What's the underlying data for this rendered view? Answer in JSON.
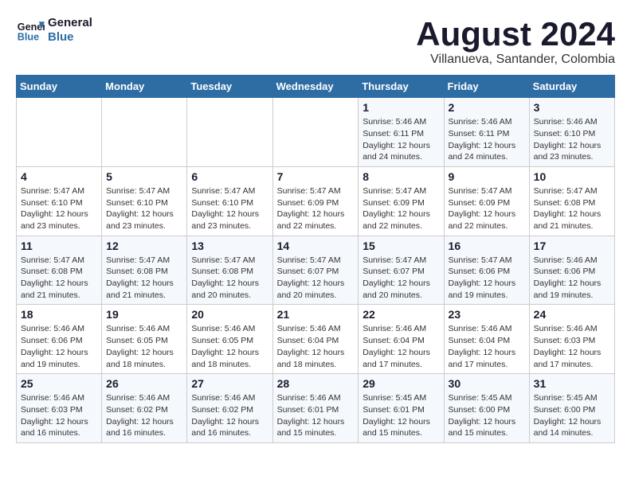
{
  "header": {
    "logo_line1": "General",
    "logo_line2": "Blue",
    "month_year": "August 2024",
    "location": "Villanueva, Santander, Colombia"
  },
  "days_of_week": [
    "Sunday",
    "Monday",
    "Tuesday",
    "Wednesday",
    "Thursday",
    "Friday",
    "Saturday"
  ],
  "weeks": [
    [
      {
        "num": "",
        "info": ""
      },
      {
        "num": "",
        "info": ""
      },
      {
        "num": "",
        "info": ""
      },
      {
        "num": "",
        "info": ""
      },
      {
        "num": "1",
        "info": "Sunrise: 5:46 AM\nSunset: 6:11 PM\nDaylight: 12 hours\nand 24 minutes."
      },
      {
        "num": "2",
        "info": "Sunrise: 5:46 AM\nSunset: 6:11 PM\nDaylight: 12 hours\nand 24 minutes."
      },
      {
        "num": "3",
        "info": "Sunrise: 5:46 AM\nSunset: 6:10 PM\nDaylight: 12 hours\nand 23 minutes."
      }
    ],
    [
      {
        "num": "4",
        "info": "Sunrise: 5:47 AM\nSunset: 6:10 PM\nDaylight: 12 hours\nand 23 minutes."
      },
      {
        "num": "5",
        "info": "Sunrise: 5:47 AM\nSunset: 6:10 PM\nDaylight: 12 hours\nand 23 minutes."
      },
      {
        "num": "6",
        "info": "Sunrise: 5:47 AM\nSunset: 6:10 PM\nDaylight: 12 hours\nand 23 minutes."
      },
      {
        "num": "7",
        "info": "Sunrise: 5:47 AM\nSunset: 6:09 PM\nDaylight: 12 hours\nand 22 minutes."
      },
      {
        "num": "8",
        "info": "Sunrise: 5:47 AM\nSunset: 6:09 PM\nDaylight: 12 hours\nand 22 minutes."
      },
      {
        "num": "9",
        "info": "Sunrise: 5:47 AM\nSunset: 6:09 PM\nDaylight: 12 hours\nand 22 minutes."
      },
      {
        "num": "10",
        "info": "Sunrise: 5:47 AM\nSunset: 6:08 PM\nDaylight: 12 hours\nand 21 minutes."
      }
    ],
    [
      {
        "num": "11",
        "info": "Sunrise: 5:47 AM\nSunset: 6:08 PM\nDaylight: 12 hours\nand 21 minutes."
      },
      {
        "num": "12",
        "info": "Sunrise: 5:47 AM\nSunset: 6:08 PM\nDaylight: 12 hours\nand 21 minutes."
      },
      {
        "num": "13",
        "info": "Sunrise: 5:47 AM\nSunset: 6:08 PM\nDaylight: 12 hours\nand 20 minutes."
      },
      {
        "num": "14",
        "info": "Sunrise: 5:47 AM\nSunset: 6:07 PM\nDaylight: 12 hours\nand 20 minutes."
      },
      {
        "num": "15",
        "info": "Sunrise: 5:47 AM\nSunset: 6:07 PM\nDaylight: 12 hours\nand 20 minutes."
      },
      {
        "num": "16",
        "info": "Sunrise: 5:47 AM\nSunset: 6:06 PM\nDaylight: 12 hours\nand 19 minutes."
      },
      {
        "num": "17",
        "info": "Sunrise: 5:46 AM\nSunset: 6:06 PM\nDaylight: 12 hours\nand 19 minutes."
      }
    ],
    [
      {
        "num": "18",
        "info": "Sunrise: 5:46 AM\nSunset: 6:06 PM\nDaylight: 12 hours\nand 19 minutes."
      },
      {
        "num": "19",
        "info": "Sunrise: 5:46 AM\nSunset: 6:05 PM\nDaylight: 12 hours\nand 18 minutes."
      },
      {
        "num": "20",
        "info": "Sunrise: 5:46 AM\nSunset: 6:05 PM\nDaylight: 12 hours\nand 18 minutes."
      },
      {
        "num": "21",
        "info": "Sunrise: 5:46 AM\nSunset: 6:04 PM\nDaylight: 12 hours\nand 18 minutes."
      },
      {
        "num": "22",
        "info": "Sunrise: 5:46 AM\nSunset: 6:04 PM\nDaylight: 12 hours\nand 17 minutes."
      },
      {
        "num": "23",
        "info": "Sunrise: 5:46 AM\nSunset: 6:04 PM\nDaylight: 12 hours\nand 17 minutes."
      },
      {
        "num": "24",
        "info": "Sunrise: 5:46 AM\nSunset: 6:03 PM\nDaylight: 12 hours\nand 17 minutes."
      }
    ],
    [
      {
        "num": "25",
        "info": "Sunrise: 5:46 AM\nSunset: 6:03 PM\nDaylight: 12 hours\nand 16 minutes."
      },
      {
        "num": "26",
        "info": "Sunrise: 5:46 AM\nSunset: 6:02 PM\nDaylight: 12 hours\nand 16 minutes."
      },
      {
        "num": "27",
        "info": "Sunrise: 5:46 AM\nSunset: 6:02 PM\nDaylight: 12 hours\nand 16 minutes."
      },
      {
        "num": "28",
        "info": "Sunrise: 5:46 AM\nSunset: 6:01 PM\nDaylight: 12 hours\nand 15 minutes."
      },
      {
        "num": "29",
        "info": "Sunrise: 5:45 AM\nSunset: 6:01 PM\nDaylight: 12 hours\nand 15 minutes."
      },
      {
        "num": "30",
        "info": "Sunrise: 5:45 AM\nSunset: 6:00 PM\nDaylight: 12 hours\nand 15 minutes."
      },
      {
        "num": "31",
        "info": "Sunrise: 5:45 AM\nSunset: 6:00 PM\nDaylight: 12 hours\nand 14 minutes."
      }
    ]
  ]
}
